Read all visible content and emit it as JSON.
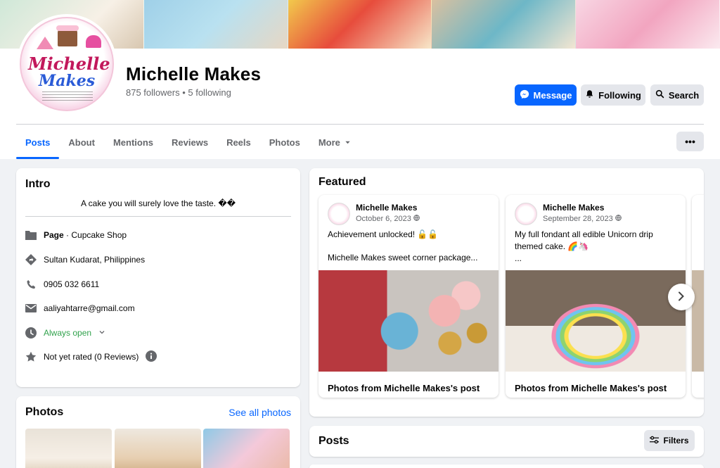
{
  "page": {
    "name": "Michelle Makes",
    "stats": "875 followers • 5 following",
    "avatar_text_1": "Michelle",
    "avatar_text_2": "Makes"
  },
  "actions": {
    "message": "Message",
    "following": "Following",
    "search": "Search",
    "more": "•••"
  },
  "tabs": [
    {
      "label": "Posts",
      "active": true
    },
    {
      "label": "About"
    },
    {
      "label": "Mentions"
    },
    {
      "label": "Reviews"
    },
    {
      "label": "Reels"
    },
    {
      "label": "Photos"
    },
    {
      "label": "More"
    }
  ],
  "intro": {
    "title": "Intro",
    "bio": "A cake you will surely love the taste. ��",
    "page_prefix": "Page",
    "category": " · Cupcake Shop",
    "location": "Sultan Kudarat, Philippines",
    "phone": "0905 032 6611",
    "email": "aaliyahtarre@gmail.com",
    "hours": "Always open",
    "rating": "Not yet rated (0 Reviews)"
  },
  "photos": {
    "title": "Photos",
    "see_all": "See all photos"
  },
  "featured": {
    "title": "Featured",
    "cards": [
      {
        "author": "Michelle Makes",
        "date": "October 6, 2023",
        "text_1": "Achievement unlocked! 🔓🔓",
        "text_2": "Michelle Makes sweet corner package...",
        "caption": "Photos from Michelle Makes's post"
      },
      {
        "author": "Michelle Makes",
        "date": "September 28, 2023",
        "text_1": "My full fondant all edible Unicorn drip themed cake. 🌈🦄",
        "text_2": "...",
        "caption": "Photos from Michelle Makes's post"
      }
    ]
  },
  "posts": {
    "title": "Posts",
    "filters": "Filters"
  },
  "colors": {
    "accent": "#0866ff",
    "secondary_button": "#e4e6eb",
    "background": "#f0f2f5",
    "open_status": "#31a24c"
  }
}
